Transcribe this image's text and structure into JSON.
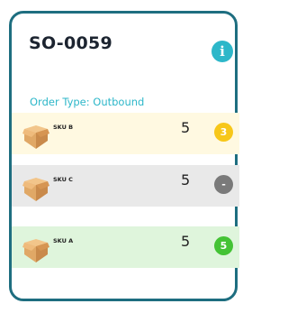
{
  "order": {
    "id": "SO-0059",
    "type_label": "Order Type: Outbound",
    "info_icon": "info-icon",
    "info_glyph": "i"
  },
  "items": [
    {
      "sku": "SKU B",
      "quantity": "5",
      "badge": "3",
      "badge_color": "#f7c719",
      "row_color": "#fff9e1",
      "icon": "package-box-icon"
    },
    {
      "sku": "SKU C",
      "quantity": "5",
      "badge": "-",
      "badge_color": "#7a7a7a",
      "row_color": "#e9e9e9",
      "icon": "package-box-icon"
    },
    {
      "sku": "SKU A",
      "quantity": "5",
      "badge": "5",
      "badge_color": "#44c335",
      "row_color": "#dff5dc",
      "icon": "package-box-icon"
    }
  ],
  "colors": {
    "border": "#1e6e80",
    "accent": "#2db7c9"
  }
}
